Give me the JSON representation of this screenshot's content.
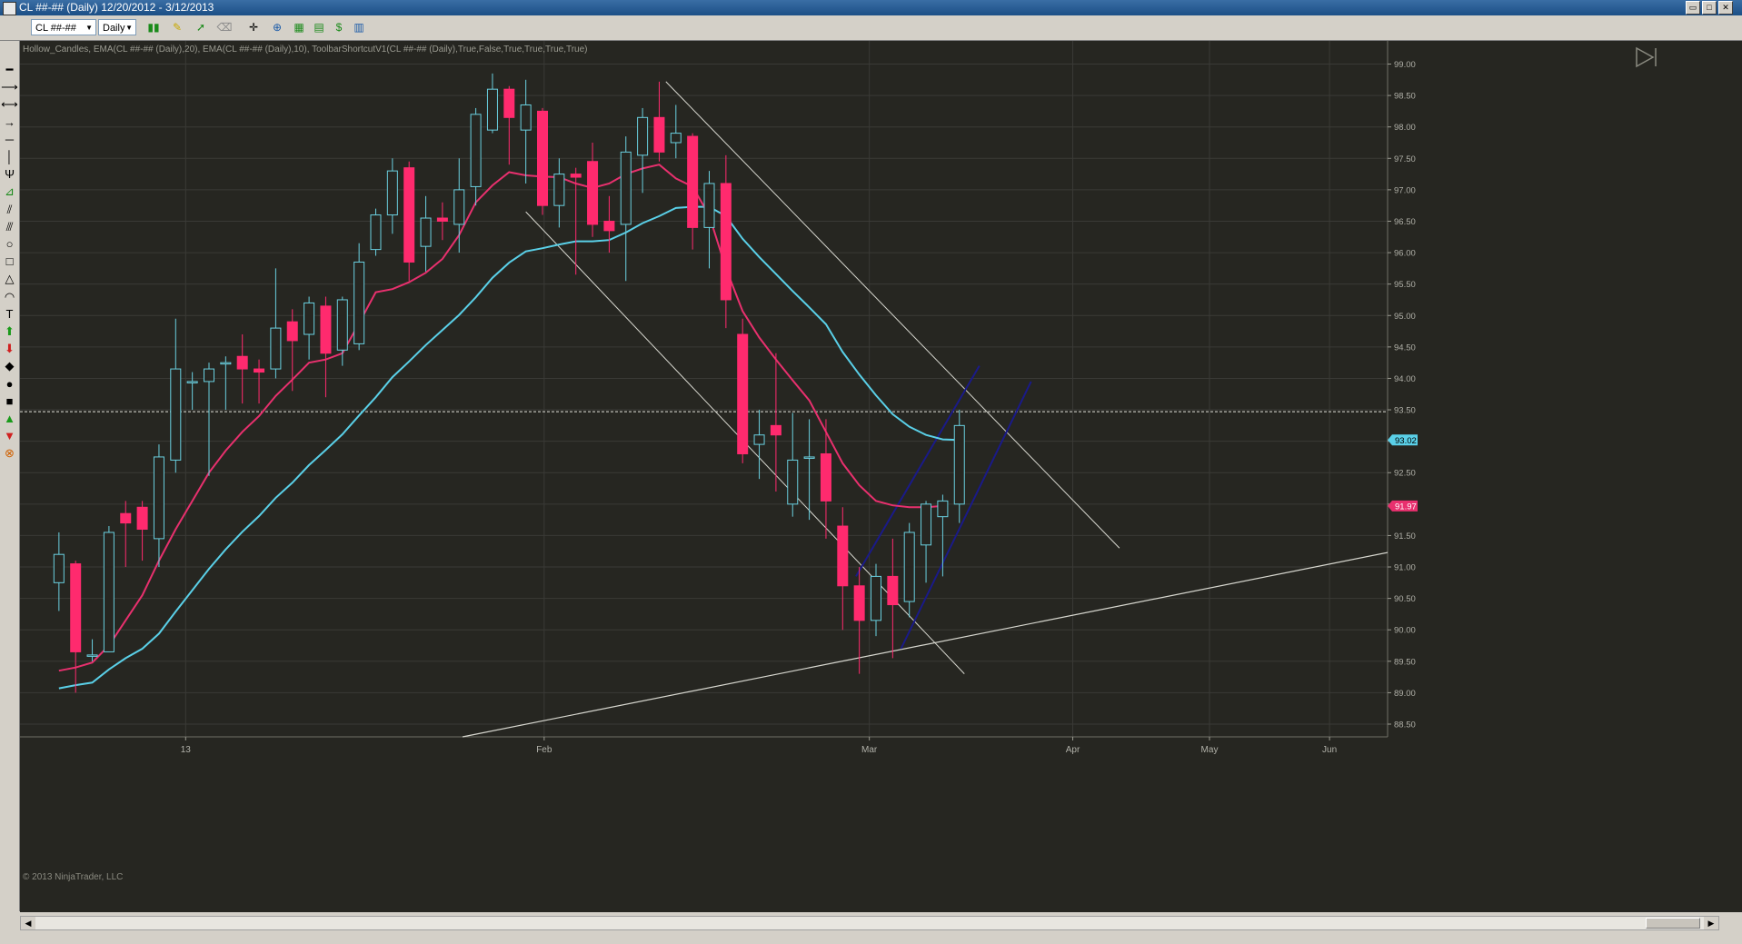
{
  "window": {
    "title": "CL ##-## (Daily)  12/20/2012 - 3/12/2013"
  },
  "toolbar": {
    "instrument": "CL ##-##",
    "interval": "Daily"
  },
  "side_tools": [
    "horizontal-line-icon",
    "ray-icon",
    "extended-line-icon",
    "arrow-line-icon",
    "line-icon",
    "vertical-line-icon",
    "andrews-pitchfork-icon",
    "fib-fan-icon",
    "parallel-channel-icon",
    "regression-channel-icon",
    "ellipse-icon",
    "rectangle-icon",
    "triangle-icon",
    "arc-icon",
    "text-icon",
    "arrow-up-icon",
    "arrow-down-icon",
    "diamond-icon",
    "dot-icon",
    "square-icon",
    "triangle-up-icon",
    "triangle-down-icon",
    "magnet-icon"
  ],
  "chart": {
    "indicator_label": "Hollow_Candles, EMA(CL ##-## (Daily),20), EMA(CL ##-## (Daily),10), ToolbarShortcutV1(CL ##-## (Daily),True,False,True,True,True,True)",
    "copyright": "© 2013 NinjaTrader, LLC",
    "colors": {
      "background": "#262621",
      "up_candle": "#6ad0e0",
      "down_candle": "#ff2a6e",
      "ema20": "#5ad0e8",
      "ema10": "#e8306e",
      "trendline": "#d8d8d0",
      "channel": "#1a1a88",
      "grid": "#3a3a36"
    }
  },
  "chart_data": {
    "type": "candlestick",
    "ylim": [
      88.5,
      99.0
    ],
    "y_ticks": [
      "99.00",
      "98.50",
      "98.00",
      "97.50",
      "97.00",
      "96.50",
      "96.00",
      "95.50",
      "95.00",
      "94.50",
      "94.00",
      "93.50",
      "93.00",
      "92.50",
      "92.00",
      "91.50",
      "91.00",
      "90.50",
      "90.00",
      "89.50",
      "89.00",
      "88.50"
    ],
    "x_tick_labels": [
      "13",
      "Feb",
      "Mar",
      "Apr",
      "May",
      "Jun"
    ],
    "candles": [
      {
        "o": 90.75,
        "h": 91.55,
        "l": 90.3,
        "c": 91.2
      },
      {
        "o": 91.05,
        "h": 91.1,
        "l": 89.0,
        "c": 89.65
      },
      {
        "o": 89.6,
        "h": 89.85,
        "l": 89.5,
        "c": 89.6
      },
      {
        "o": 89.65,
        "h": 91.65,
        "l": 89.65,
        "c": 91.55
      },
      {
        "o": 91.85,
        "h": 92.05,
        "l": 91.0,
        "c": 91.7
      },
      {
        "o": 91.95,
        "h": 92.05,
        "l": 91.1,
        "c": 91.6
      },
      {
        "o": 91.45,
        "h": 92.95,
        "l": 91.0,
        "c": 92.75
      },
      {
        "o": 92.7,
        "h": 94.95,
        "l": 92.5,
        "c": 94.15
      },
      {
        "o": 93.95,
        "h": 94.1,
        "l": 93.5,
        "c": 93.95
      },
      {
        "o": 93.95,
        "h": 94.25,
        "l": 92.45,
        "c": 94.15
      },
      {
        "o": 94.25,
        "h": 94.35,
        "l": 93.5,
        "c": 94.25
      },
      {
        "o": 94.35,
        "h": 94.7,
        "l": 93.6,
        "c": 94.15
      },
      {
        "o": 94.15,
        "h": 94.3,
        "l": 93.6,
        "c": 94.1
      },
      {
        "o": 94.15,
        "h": 95.75,
        "l": 94.0,
        "c": 94.8
      },
      {
        "o": 94.9,
        "h": 95.1,
        "l": 93.8,
        "c": 94.6
      },
      {
        "o": 94.7,
        "h": 95.3,
        "l": 94.3,
        "c": 95.2
      },
      {
        "o": 95.15,
        "h": 95.3,
        "l": 93.7,
        "c": 94.4
      },
      {
        "o": 94.45,
        "h": 95.3,
        "l": 94.2,
        "c": 95.25
      },
      {
        "o": 94.55,
        "h": 96.15,
        "l": 94.45,
        "c": 95.85
      },
      {
        "o": 96.05,
        "h": 96.7,
        "l": 95.95,
        "c": 96.6
      },
      {
        "o": 96.6,
        "h": 97.5,
        "l": 96.3,
        "c": 97.3
      },
      {
        "o": 97.35,
        "h": 97.45,
        "l": 95.55,
        "c": 95.85
      },
      {
        "o": 96.1,
        "h": 96.9,
        "l": 95.7,
        "c": 96.55
      },
      {
        "o": 96.55,
        "h": 96.8,
        "l": 96.2,
        "c": 96.5
      },
      {
        "o": 96.45,
        "h": 97.5,
        "l": 96.0,
        "c": 97.0
      },
      {
        "o": 97.05,
        "h": 98.3,
        "l": 96.75,
        "c": 98.2
      },
      {
        "o": 97.95,
        "h": 98.85,
        "l": 97.9,
        "c": 98.6
      },
      {
        "o": 98.6,
        "h": 98.65,
        "l": 97.4,
        "c": 98.15
      },
      {
        "o": 97.95,
        "h": 98.75,
        "l": 97.1,
        "c": 98.35
      },
      {
        "o": 98.25,
        "h": 98.3,
        "l": 96.6,
        "c": 96.75
      },
      {
        "o": 96.75,
        "h": 97.5,
        "l": 96.4,
        "c": 97.25
      },
      {
        "o": 97.25,
        "h": 97.35,
        "l": 95.65,
        "c": 97.2
      },
      {
        "o": 97.45,
        "h": 97.75,
        "l": 96.25,
        "c": 96.45
      },
      {
        "o": 96.5,
        "h": 96.9,
        "l": 96.0,
        "c": 96.35
      },
      {
        "o": 96.45,
        "h": 97.85,
        "l": 95.55,
        "c": 97.6
      },
      {
        "o": 97.55,
        "h": 98.3,
        "l": 96.95,
        "c": 98.15
      },
      {
        "o": 98.15,
        "h": 98.72,
        "l": 97.45,
        "c": 97.6
      },
      {
        "o": 97.75,
        "h": 98.35,
        "l": 97.5,
        "c": 97.9
      },
      {
        "o": 97.85,
        "h": 97.9,
        "l": 96.05,
        "c": 96.4
      },
      {
        "o": 96.4,
        "h": 97.3,
        "l": 95.75,
        "c": 97.1
      },
      {
        "o": 97.1,
        "h": 97.55,
        "l": 94.8,
        "c": 95.25
      },
      {
        "o": 94.7,
        "h": 94.95,
        "l": 92.65,
        "c": 92.8
      },
      {
        "o": 92.95,
        "h": 93.5,
        "l": 92.4,
        "c": 93.1
      },
      {
        "o": 93.25,
        "h": 94.4,
        "l": 92.2,
        "c": 93.1
      },
      {
        "o": 92.0,
        "h": 93.45,
        "l": 91.8,
        "c": 92.7
      },
      {
        "o": 92.75,
        "h": 93.35,
        "l": 91.75,
        "c": 92.75
      },
      {
        "o": 92.8,
        "h": 93.35,
        "l": 91.45,
        "c": 92.05
      },
      {
        "o": 91.65,
        "h": 91.95,
        "l": 90.0,
        "c": 90.7
      },
      {
        "o": 90.7,
        "h": 91.0,
        "l": 89.3,
        "c": 90.15
      },
      {
        "o": 90.15,
        "h": 91.05,
        "l": 89.9,
        "c": 90.85
      },
      {
        "o": 90.85,
        "h": 91.45,
        "l": 89.55,
        "c": 90.4
      },
      {
        "o": 90.45,
        "h": 91.7,
        "l": 90.2,
        "c": 91.55
      },
      {
        "o": 91.35,
        "h": 92.05,
        "l": 90.75,
        "c": 92.0
      },
      {
        "o": 91.8,
        "h": 92.15,
        "l": 90.85,
        "c": 92.05
      },
      {
        "o": 92.0,
        "h": 93.5,
        "l": 91.7,
        "c": 93.25
      }
    ],
    "series": [
      {
        "name": "EMA(CL ##-## (Daily),20)",
        "values": [
          89.07,
          89.12,
          89.16,
          89.37,
          89.55,
          89.7,
          89.94,
          90.29,
          90.63,
          90.97,
          91.28,
          91.56,
          91.81,
          92.1,
          92.34,
          92.62,
          92.86,
          93.11,
          93.41,
          93.7,
          94.02,
          94.27,
          94.53,
          94.77,
          95.01,
          95.29,
          95.6,
          95.84,
          96.02,
          96.07,
          96.13,
          96.18,
          96.18,
          96.2,
          96.32,
          96.47,
          96.58,
          96.71,
          96.73,
          96.73,
          96.58,
          96.22,
          95.93,
          95.66,
          95.39,
          95.13,
          94.86,
          94.42,
          94.06,
          93.73,
          93.43,
          93.23,
          93.1,
          93.03,
          93.02
        ]
      },
      {
        "name": "EMA(CL ##-## (Daily),10)",
        "values": [
          89.35,
          89.4,
          89.48,
          89.75,
          90.15,
          90.55,
          91.1,
          91.6,
          92.05,
          92.5,
          92.85,
          93.15,
          93.4,
          93.72,
          93.98,
          94.25,
          94.3,
          94.4,
          94.88,
          95.37,
          95.42,
          95.53,
          95.68,
          95.9,
          96.28,
          96.8,
          97.07,
          97.28,
          97.23,
          97.21,
          97.2,
          97.1,
          97.03,
          97.1,
          97.25,
          97.34,
          97.4,
          97.18,
          97.05,
          96.59,
          95.75,
          95.07,
          94.65,
          94.3,
          93.97,
          93.65,
          93.15,
          92.65,
          92.3,
          92.05,
          91.98,
          91.95,
          91.95,
          91.97
        ]
      },
      {
        "name": "Trendline (support)",
        "values": []
      },
      {
        "name": "Descending channel",
        "values": []
      },
      {
        "name": "Ascending channel",
        "values": []
      }
    ],
    "price_markers": [
      {
        "value": "93.02",
        "color": "#5ad0e8",
        "text_color": "#000000"
      },
      {
        "value": "91.97",
        "color": "#e8306e",
        "text_color": "#ffffff"
      }
    ],
    "horizontal_line": 93.47,
    "support_line": [
      [
        0,
        88.5
      ],
      [
        100,
        91.23
      ]
    ]
  }
}
